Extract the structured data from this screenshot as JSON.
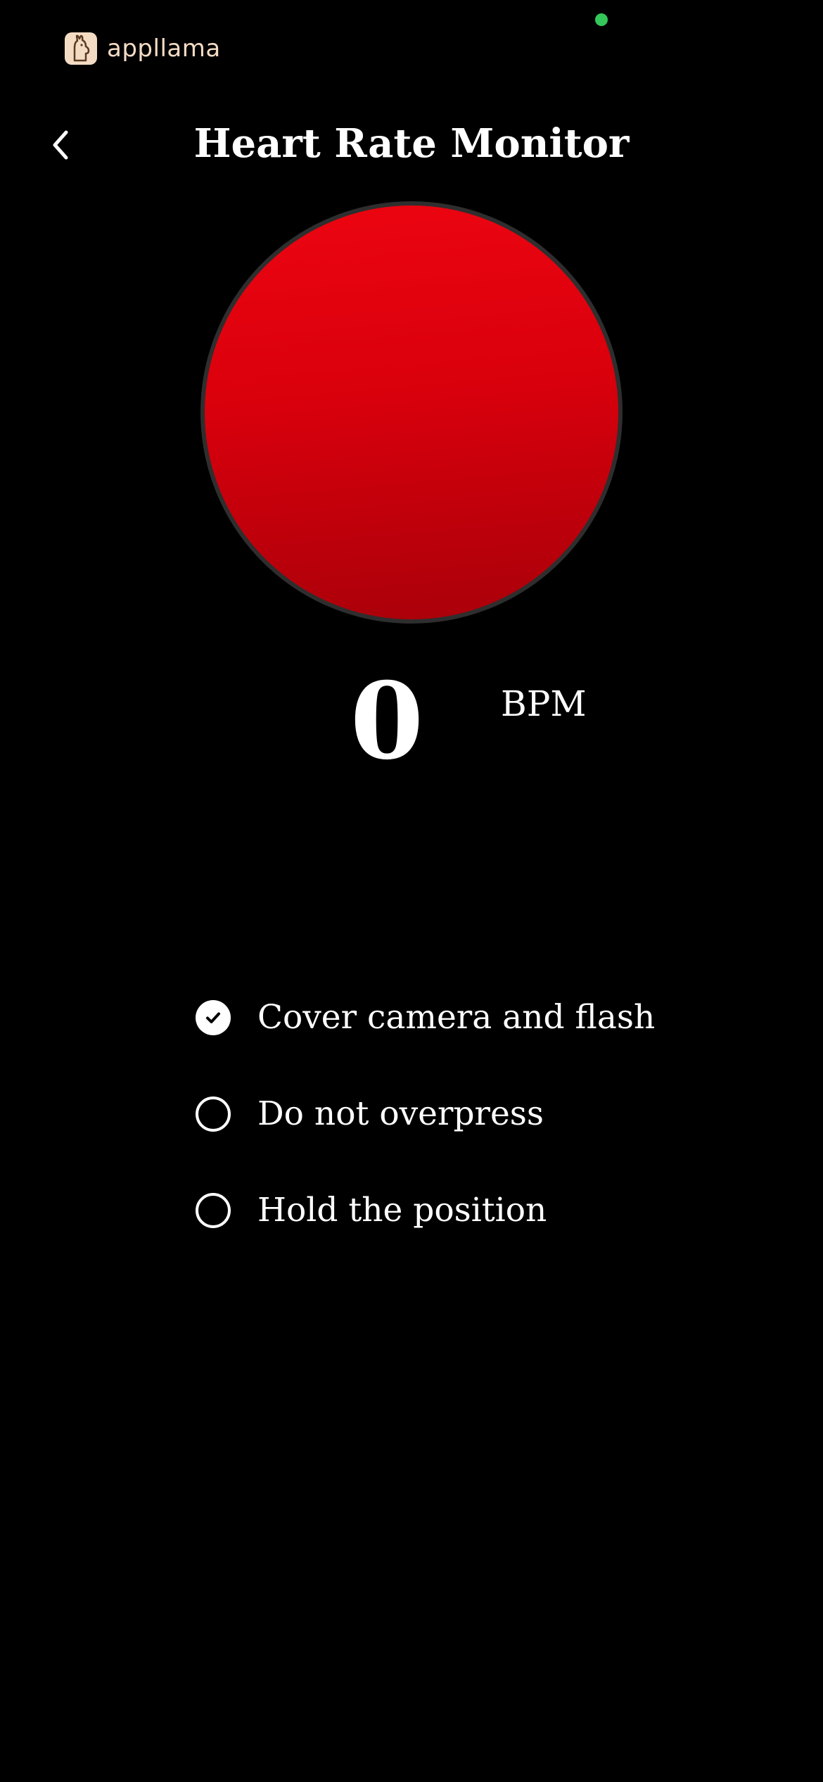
{
  "brand": {
    "name": "appllama",
    "logo_icon": "llama-logo-icon",
    "color": "#f4dcc4"
  },
  "status": {
    "indicator_color": "#34c759"
  },
  "header": {
    "back_icon": "chevron-left-icon",
    "title": "Heart Rate Monitor"
  },
  "sensor": {
    "color_top": "#ec0511",
    "color_bottom": "#a8000a"
  },
  "reading": {
    "value": "0",
    "unit": "BPM"
  },
  "checklist": {
    "items": [
      {
        "label": "Cover camera and flash",
        "checked": true
      },
      {
        "label": "Do not overpress",
        "checked": false
      },
      {
        "label": "Hold the position",
        "checked": false
      }
    ]
  }
}
